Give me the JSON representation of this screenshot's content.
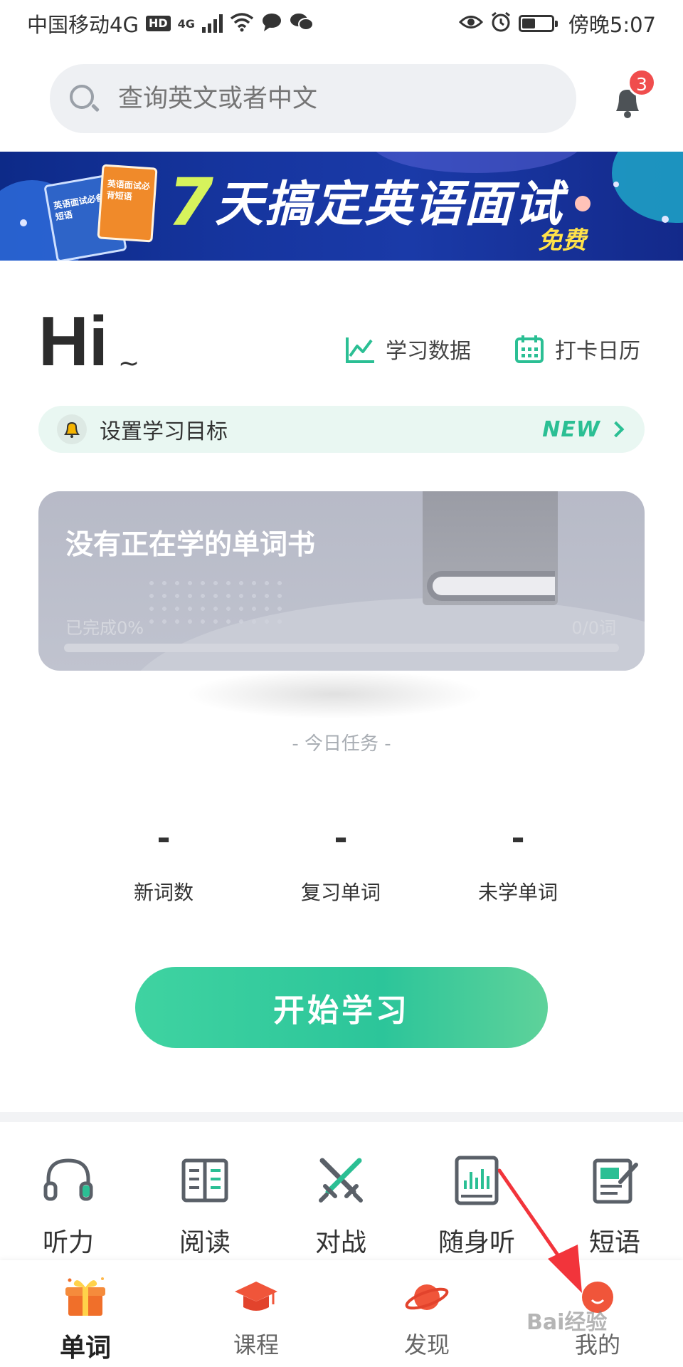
{
  "status_bar": {
    "carrier": "中国移动4G",
    "hd": "HD",
    "net": "4G",
    "time": "傍晚5:07",
    "battery_level": 0.45
  },
  "search": {
    "placeholder": "查询英文或者中文"
  },
  "notifications": {
    "count": "3"
  },
  "banner": {
    "number": "7",
    "headline": "天搞定英语面试",
    "tag": "免费",
    "book1": "英语面试必备短语",
    "book2": "英语面试必背短语"
  },
  "greeting": {
    "hi": "Hi",
    "tilde": "~"
  },
  "quick_links": {
    "study_data": "学习数据",
    "checkin_calendar": "打卡日历"
  },
  "goal": {
    "label": "设置学习目标",
    "new": "NEW"
  },
  "book_card": {
    "title": "没有正在学的单词书",
    "done_text": "已完成0%",
    "count_text": "0/0词",
    "progress": 0
  },
  "tasks": {
    "header": "- 今日任务 -",
    "stats": [
      {
        "value": "-",
        "label": "新词数"
      },
      {
        "value": "-",
        "label": "复习单词"
      },
      {
        "value": "-",
        "label": "未学单词"
      }
    ],
    "start_label": "开始学习"
  },
  "tools": [
    {
      "label": "听力",
      "icon": "headphones-icon"
    },
    {
      "label": "阅读",
      "icon": "reading-book-icon"
    },
    {
      "label": "对战",
      "icon": "crossed-swords-icon"
    },
    {
      "label": "随身听",
      "icon": "audio-player-icon"
    },
    {
      "label": "短语",
      "icon": "note-edit-icon"
    }
  ],
  "nav": [
    {
      "label": "单词",
      "icon": "gift-box-icon",
      "active": true
    },
    {
      "label": "课程",
      "icon": "graduation-cap-icon",
      "active": false
    },
    {
      "label": "发现",
      "icon": "planet-icon",
      "active": false
    },
    {
      "label": "我的",
      "icon": "profile-avatar-icon",
      "active": false
    }
  ],
  "watermark": "Bai经验",
  "colors": {
    "accent": "#2bbf94",
    "badge": "#f04d4d",
    "banner_bg": "#16359f",
    "annotation_arrow": "#f2343b"
  }
}
